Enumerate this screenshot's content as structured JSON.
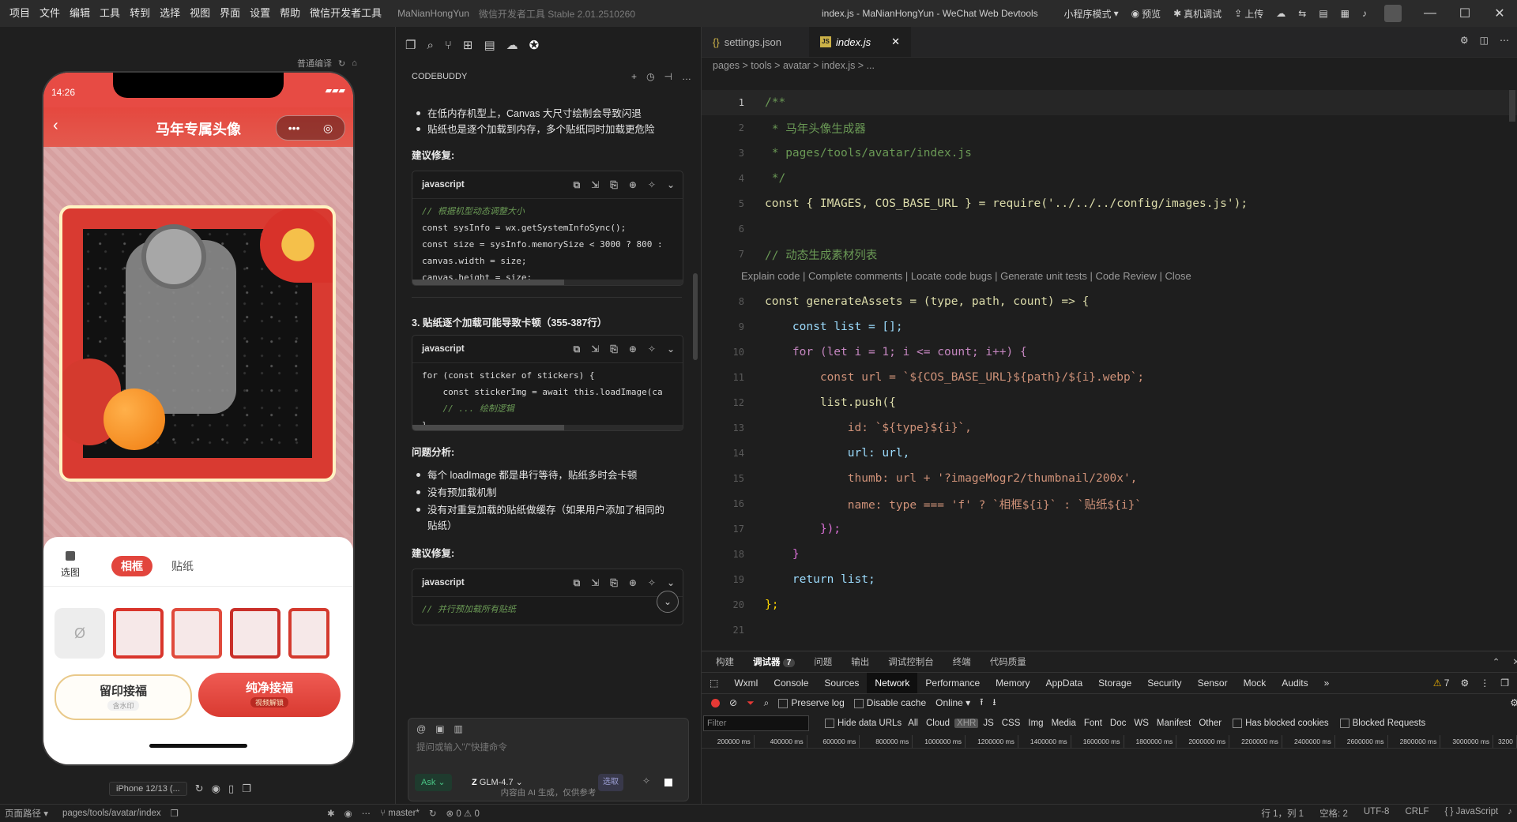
{
  "titlebar": {
    "menu": [
      "项目",
      "文件",
      "编辑",
      "工具",
      "转到",
      "选择",
      "视图",
      "界面",
      "设置",
      "帮助",
      "微信开发者工具"
    ],
    "app_name": "MaNianHongYun",
    "app_version": "微信开发者工具 Stable 2.01.2510260",
    "mode": "小程序模式",
    "preview": "预览",
    "real_device": "真机调试",
    "upload": "上传",
    "center_title": "index.js - MaNianHongYun - WeChat Web Devtools"
  },
  "simulator": {
    "compile_mode": "普通编译",
    "time": "14:26",
    "nav_title": "马年专属头像",
    "tab_upload": "选图",
    "tab_frame": "相框",
    "tab_sticker": "贴纸",
    "empty_symbol": "Ø",
    "btn_keep": "留印接福",
    "btn_keep_sub": "含水印",
    "btn_clean": "纯净接福",
    "btn_clean_sub": "视频解锁",
    "device": "iPhone 12/13 (..."
  },
  "codebuddy": {
    "title": "CODEBUDDY",
    "bullets_top": [
      "在低内存机型上，Canvas 大尺寸绘制会导致闪退",
      "贴纸也是逐个加载到内存，多个贴纸同时加载更危险"
    ],
    "fix_heading": "建议修复:",
    "code1_lang": "javascript",
    "code1_lines": [
      "// 根据机型动态调整大小",
      "const sysInfo = wx.getSystemInfoSync();",
      "const size = sysInfo.memorySize < 3000 ? 800 :",
      "canvas.width = size;",
      "canvas.height = size;"
    ],
    "section3": "3. 贴纸逐个加载可能导致卡顿（355-387行）",
    "code2_lang": "javascript",
    "code2_lines": [
      "for (const sticker of stickers) {",
      "    const stickerImg = await this.loadImage(ca",
      "    // ... 绘制逻辑",
      "}"
    ],
    "analysis_heading": "问题分析:",
    "analysis_bullets": [
      "每个 loadImage 都是串行等待，贴纸多时会卡顿",
      "没有预加载机制",
      "没有对重复加载的贴纸做缓存（如果用户添加了相同的贴纸）"
    ],
    "fix_heading2": "建议修复:",
    "code3_lang": "javascript",
    "code3_line": "// 并行预加载所有贴纸",
    "input_placeholder": "提问或输入\"/\"快捷命令",
    "ask": "Ask",
    "model": "GLM-4.7",
    "select": "选取",
    "footer": "内容由 AI 生成，仅供参考"
  },
  "editor": {
    "tab1": "settings.json",
    "tab2": "index.js",
    "breadcrumb": "pages  >  tools  >  avatar  >  index.js  >  ...",
    "codelens": "Explain code | Complete comments | Locate code bugs | Generate unit tests | Code Review | Close",
    "lines": [
      {
        "n": "1",
        "t": "/**"
      },
      {
        "n": "2",
        "t": " * 马年头像生成器"
      },
      {
        "n": "3",
        "t": " * pages/tools/avatar/index.js"
      },
      {
        "n": "4",
        "t": " */"
      },
      {
        "n": "5",
        "t": "const { IMAGES, COS_BASE_URL } = require('../../../config/images.js');"
      },
      {
        "n": "6",
        "t": ""
      },
      {
        "n": "7",
        "t": "// 动态生成素材列表"
      },
      {
        "n": "8",
        "t": "const generateAssets = (type, path, count) => {"
      },
      {
        "n": "9",
        "t": "    const list = [];"
      },
      {
        "n": "10",
        "t": "    for (let i = 1; i <= count; i++) {"
      },
      {
        "n": "11",
        "t": "        const url = `${COS_BASE_URL}${path}/${i}.webp`;"
      },
      {
        "n": "12",
        "t": "        list.push({"
      },
      {
        "n": "13",
        "t": "            id: `${type}${i}`,"
      },
      {
        "n": "14",
        "t": "            url: url,"
      },
      {
        "n": "15",
        "t": "            thumb: url + '?imageMogr2/thumbnail/200x',"
      },
      {
        "n": "16",
        "t": "            name: type === 'f' ? `相框${i}` : `贴纸${i}`"
      },
      {
        "n": "17",
        "t": "        });"
      },
      {
        "n": "18",
        "t": "    }"
      },
      {
        "n": "19",
        "t": "    return list;"
      },
      {
        "n": "20",
        "t": "};"
      },
      {
        "n": "21",
        "t": ""
      }
    ]
  },
  "devtools": {
    "top_tabs": [
      "构建",
      "调试器",
      "问题",
      "输出",
      "调试控制台",
      "终端",
      "代码质量"
    ],
    "debugger_count": "7",
    "tabs": [
      "Wxml",
      "Console",
      "Sources",
      "Network",
      "Performance",
      "Memory",
      "AppData",
      "Storage",
      "Security",
      "Sensor",
      "Mock",
      "Audits"
    ],
    "warn_count": "7",
    "preserve_log": "Preserve log",
    "disable_cache": "Disable cache",
    "online": "Online",
    "filter_placeholder": "Filter",
    "types": [
      "Hide data URLs",
      "All",
      "Cloud",
      "XHR",
      "JS",
      "CSS",
      "Img",
      "Media",
      "Font",
      "Doc",
      "WS",
      "Manifest",
      "Other"
    ],
    "has_blocked": "Has blocked cookies",
    "blocked_requests": "Blocked Requests",
    "timeline": [
      "200000 ms",
      "400000 ms",
      "600000 ms",
      "800000 ms",
      "1000000 ms",
      "1200000 ms",
      "1400000 ms",
      "1600000 ms",
      "1800000 ms",
      "2000000 ms",
      "2200000 ms",
      "2400000 ms",
      "2600000 ms",
      "2800000 ms",
      "3000000 ms",
      "3200"
    ]
  },
  "statusbar": {
    "page_path_label": "页面路径",
    "page_path": "pages/tools/avatar/index",
    "branch": "master*",
    "errors": "⊗ 0 ⚠ 0",
    "position": "行 1，列 1",
    "spaces": "空格: 2",
    "encoding": "UTF-8",
    "eol": "CRLF",
    "language": "JavaScript"
  }
}
